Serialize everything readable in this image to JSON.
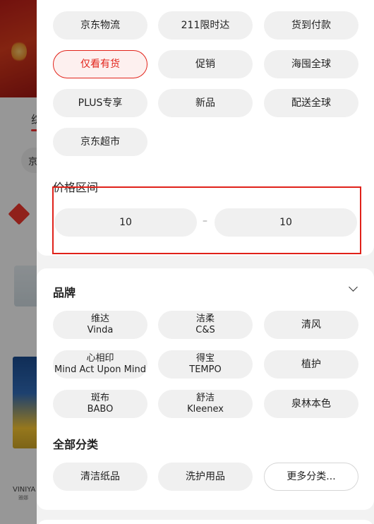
{
  "background": {
    "tab_fragment": "综",
    "chip_fragment": "京",
    "brand_fragment": "VINIYA",
    "brand_sub_fragment": "雅娜"
  },
  "service_filters": [
    {
      "label": "京东物流",
      "selected": false
    },
    {
      "label": "211限时达",
      "selected": false
    },
    {
      "label": "货到付款",
      "selected": false
    },
    {
      "label": "仅看有货",
      "selected": true
    },
    {
      "label": "促销",
      "selected": false
    },
    {
      "label": "海囤全球",
      "selected": false
    },
    {
      "label": "PLUS专享",
      "selected": false
    },
    {
      "label": "新品",
      "selected": false
    },
    {
      "label": "配送全球",
      "selected": false
    },
    {
      "label": "京东超市",
      "selected": false
    }
  ],
  "price": {
    "title": "价格区间",
    "min_value": "10",
    "max_value": "10",
    "separator": "–"
  },
  "brand": {
    "title": "品牌",
    "items": [
      {
        "line1": "维达",
        "line2": "Vinda"
      },
      {
        "line1": "洁柔",
        "line2": "C&S"
      },
      {
        "line1": "清风",
        "line2": ""
      },
      {
        "line1": "心相印",
        "line2": "Mind Act Upon Mind"
      },
      {
        "line1": "得宝",
        "line2": "TEMPO"
      },
      {
        "line1": "植护",
        "line2": ""
      },
      {
        "line1": "斑布",
        "line2": "BABO"
      },
      {
        "line1": "舒洁",
        "line2": "Kleenex"
      },
      {
        "line1": "泉林本色",
        "line2": ""
      }
    ]
  },
  "category": {
    "title": "全部分类",
    "items": [
      "清洁纸品",
      "洗护用品"
    ],
    "more_label": "更多分类..."
  },
  "colors": {
    "accent": "#e2231a",
    "chip_bg": "#f0f0f0",
    "selected_bg": "#fdf0ef"
  },
  "icons": {
    "brand_toggle": "chevron-down-icon"
  }
}
